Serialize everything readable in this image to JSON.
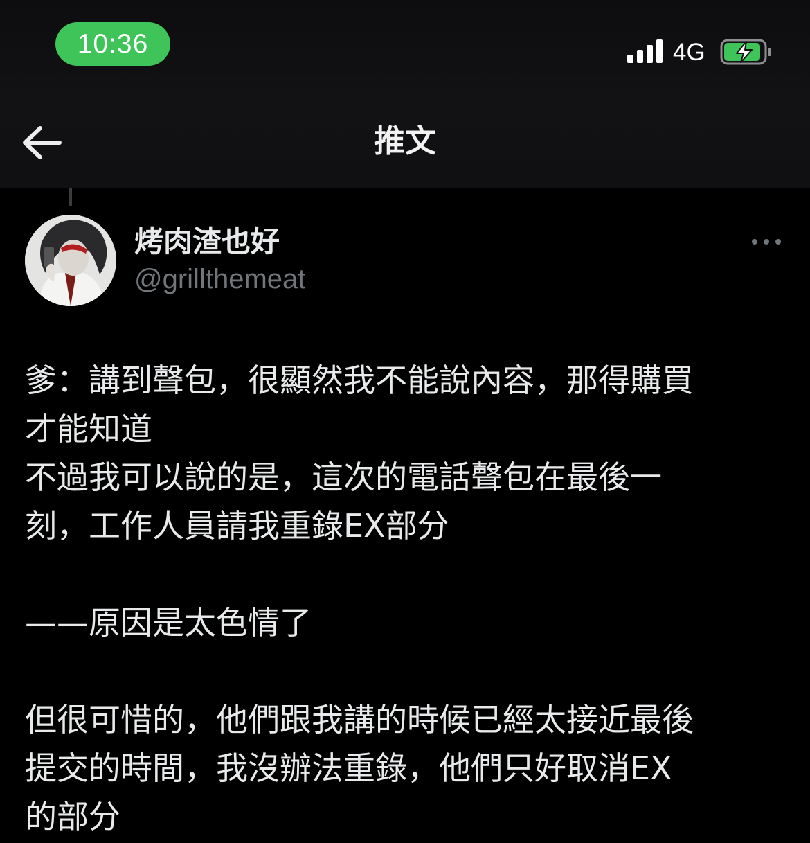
{
  "status_bar": {
    "time": "10:36",
    "network": "4G",
    "icons": [
      "signal-icon",
      "battery-charging-icon"
    ]
  },
  "nav": {
    "back_icon": "back-arrow-icon",
    "title": "推文"
  },
  "tweet": {
    "author": {
      "display_name": "烤肉渣也好",
      "handle": "@grillthemeat"
    },
    "more_icon": "more-options-icon",
    "lines": [
      "爹：講到聲包，很顯然我不能說內容，那得購買",
      "才能知道",
      "不過我可以說的是，這次的電話聲包在最後一",
      "刻，工作人員請我重錄EX部分",
      "",
      "——原因是太色情了",
      "",
      "但很可惜的，他們跟我講的時候已經太接近最後",
      "提交的時間，我沒辦法重錄，他們只好取消EX",
      "的部分"
    ]
  },
  "colors": {
    "background": "#000000",
    "text_primary": "#e7e9ea",
    "text_secondary": "#71767b",
    "time_pill": "#3fc45a",
    "battery_fill": "#3fc45a"
  }
}
